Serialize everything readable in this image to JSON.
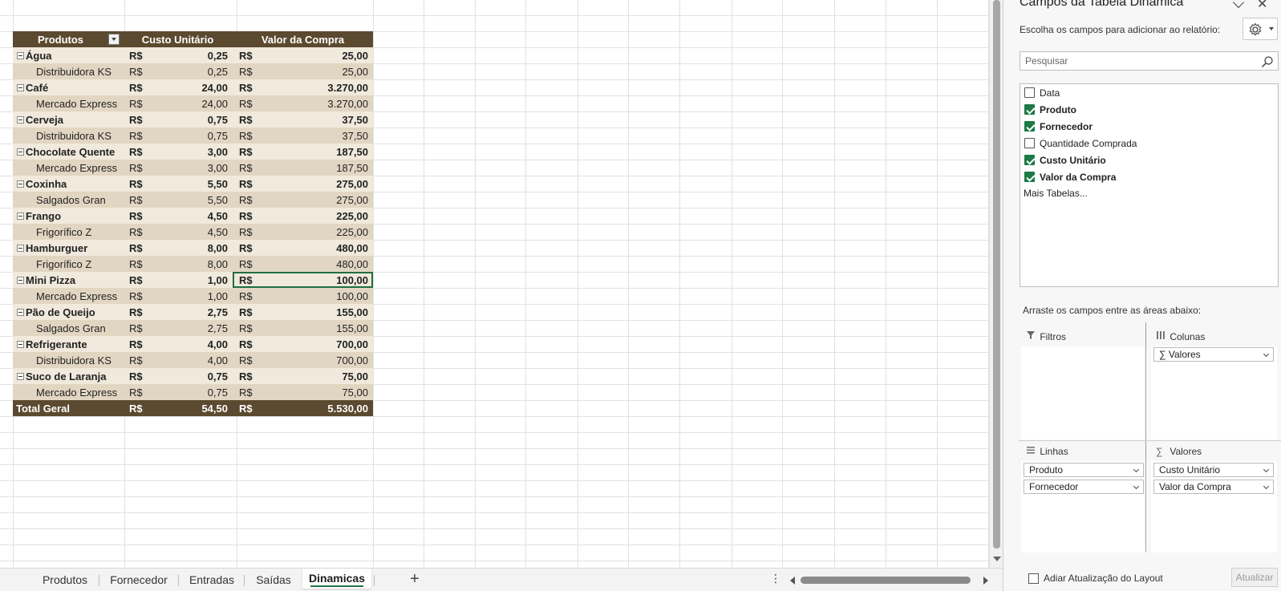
{
  "pivot": {
    "headers": [
      "Produtos",
      "Custo Unitário",
      "Valor da Compra"
    ],
    "currency": "R$",
    "rows": [
      {
        "type": "group",
        "label": "Água",
        "cost": "0,25",
        "value": "25,00"
      },
      {
        "type": "child",
        "label": "Distribuidora KS",
        "cost": "0,25",
        "value": "25,00"
      },
      {
        "type": "group",
        "label": "Café",
        "cost": "24,00",
        "value": "3.270,00"
      },
      {
        "type": "child",
        "label": "Mercado Express",
        "cost": "24,00",
        "value": "3.270,00"
      },
      {
        "type": "group",
        "label": "Cerveja",
        "cost": "0,75",
        "value": "37,50"
      },
      {
        "type": "child",
        "label": "Distribuidora KS",
        "cost": "0,75",
        "value": "37,50"
      },
      {
        "type": "group",
        "label": "Chocolate Quente",
        "cost": "3,00",
        "value": "187,50"
      },
      {
        "type": "child",
        "label": "Mercado Express",
        "cost": "3,00",
        "value": "187,50"
      },
      {
        "type": "group",
        "label": "Coxinha",
        "cost": "5,50",
        "value": "275,00"
      },
      {
        "type": "child",
        "label": "Salgados Gran",
        "cost": "5,50",
        "value": "275,00"
      },
      {
        "type": "group",
        "label": "Frango",
        "cost": "4,50",
        "value": "225,00"
      },
      {
        "type": "child",
        "label": "Frigorífico Z",
        "cost": "4,50",
        "value": "225,00"
      },
      {
        "type": "group",
        "label": "Hamburguer",
        "cost": "8,00",
        "value": "480,00"
      },
      {
        "type": "child",
        "label": "Frigorífico Z",
        "cost": "8,00",
        "value": "480,00"
      },
      {
        "type": "group",
        "label": "Mini Pizza",
        "cost": "1,00",
        "value": "100,00",
        "selected": true
      },
      {
        "type": "child",
        "label": "Mercado Express",
        "cost": "1,00",
        "value": "100,00"
      },
      {
        "type": "group",
        "label": "Pão de Queijo",
        "cost": "2,75",
        "value": "155,00"
      },
      {
        "type": "child",
        "label": "Salgados Gran",
        "cost": "2,75",
        "value": "155,00"
      },
      {
        "type": "group",
        "label": "Refrigerante",
        "cost": "4,00",
        "value": "700,00"
      },
      {
        "type": "child",
        "label": "Distribuidora KS",
        "cost": "4,00",
        "value": "700,00"
      },
      {
        "type": "group",
        "label": "Suco de Laranja",
        "cost": "0,75",
        "value": "75,00"
      },
      {
        "type": "child",
        "label": "Mercado Express",
        "cost": "0,75",
        "value": "75,00"
      },
      {
        "type": "total",
        "label": "Total Geral",
        "cost": "54,50",
        "value": "5.530,00"
      }
    ]
  },
  "sheet_tabs": {
    "tabs": [
      "Produtos",
      "Fornecedor",
      "Entradas",
      "Saídas",
      "Dinamicas"
    ],
    "active": "Dinamicas",
    "add_label": "+",
    "menu_label": "⋮"
  },
  "pane": {
    "title": "Campos da Tabela Dinâmica",
    "subtitle": "Escolha os campos para adicionar ao relatório:",
    "search_placeholder": "Pesquisar",
    "fields": [
      {
        "label": "Data",
        "checked": false
      },
      {
        "label": "Produto",
        "checked": true
      },
      {
        "label": "Fornecedor",
        "checked": true
      },
      {
        "label": "Quantidade Comprada",
        "checked": false
      },
      {
        "label": "Custo Unitário",
        "checked": true
      },
      {
        "label": "Valor da Compra",
        "checked": true
      }
    ],
    "more_tables": "Mais Tabelas...",
    "drag_hint": "Arraste os campos entre as áreas abaixo:",
    "areas": {
      "filters": {
        "title": "Filtros",
        "items": []
      },
      "columns": {
        "title": "Colunas",
        "items": [
          "∑ Valores"
        ]
      },
      "rows": {
        "title": "Linhas",
        "items": [
          "Produto",
          "Fornecedor"
        ]
      },
      "values": {
        "title": "Valores",
        "items": [
          "Custo Unitário",
          "Valor da Compra"
        ]
      }
    },
    "defer_label": "Adiar Atualização do Layout",
    "update_label": "Atualizar"
  },
  "colors": {
    "header_bg": "#5b4a2f",
    "group_row_bg": "#f0e9dc",
    "child_row_bg": "#e1d6c2",
    "accent_green": "#1b7a45"
  }
}
